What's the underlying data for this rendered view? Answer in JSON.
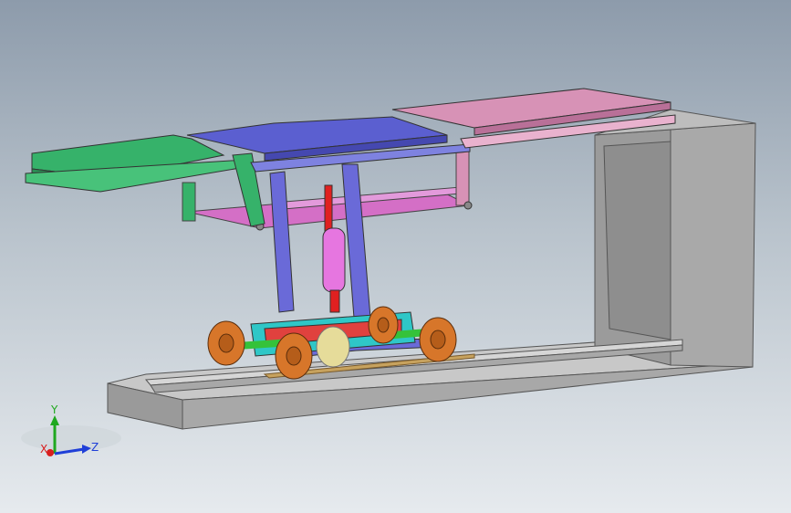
{
  "triad": {
    "y_label": "Y",
    "z_label": "Z",
    "x_label": "X",
    "y_color": "#1fa81f",
    "z_color": "#1f3fd8",
    "x_color": "#d81f1f"
  },
  "model": {
    "parts": [
      {
        "part": "base-frame",
        "color": "#a9a9a9"
      },
      {
        "part": "rail",
        "color": "#b5b5b5"
      },
      {
        "part": "platform-left",
        "color": "#36b26a"
      },
      {
        "part": "platform-center",
        "color": "#5b5fd0"
      },
      {
        "part": "platform-right",
        "color": "#d792b6"
      },
      {
        "part": "lift-frame",
        "color": "#d46fc6"
      },
      {
        "part": "column",
        "color": "#6a6ad8"
      },
      {
        "part": "cylinder",
        "color": "#e676e0"
      },
      {
        "part": "piston-rod",
        "color": "#e02020"
      },
      {
        "part": "carriage",
        "color": "#2fc7c7"
      },
      {
        "part": "wheel",
        "color": "#d7762a"
      },
      {
        "part": "axle",
        "color": "#35c23a"
      },
      {
        "part": "gear",
        "color": "#e6dc9a"
      },
      {
        "part": "rack",
        "color": "#c7a25e"
      }
    ]
  }
}
